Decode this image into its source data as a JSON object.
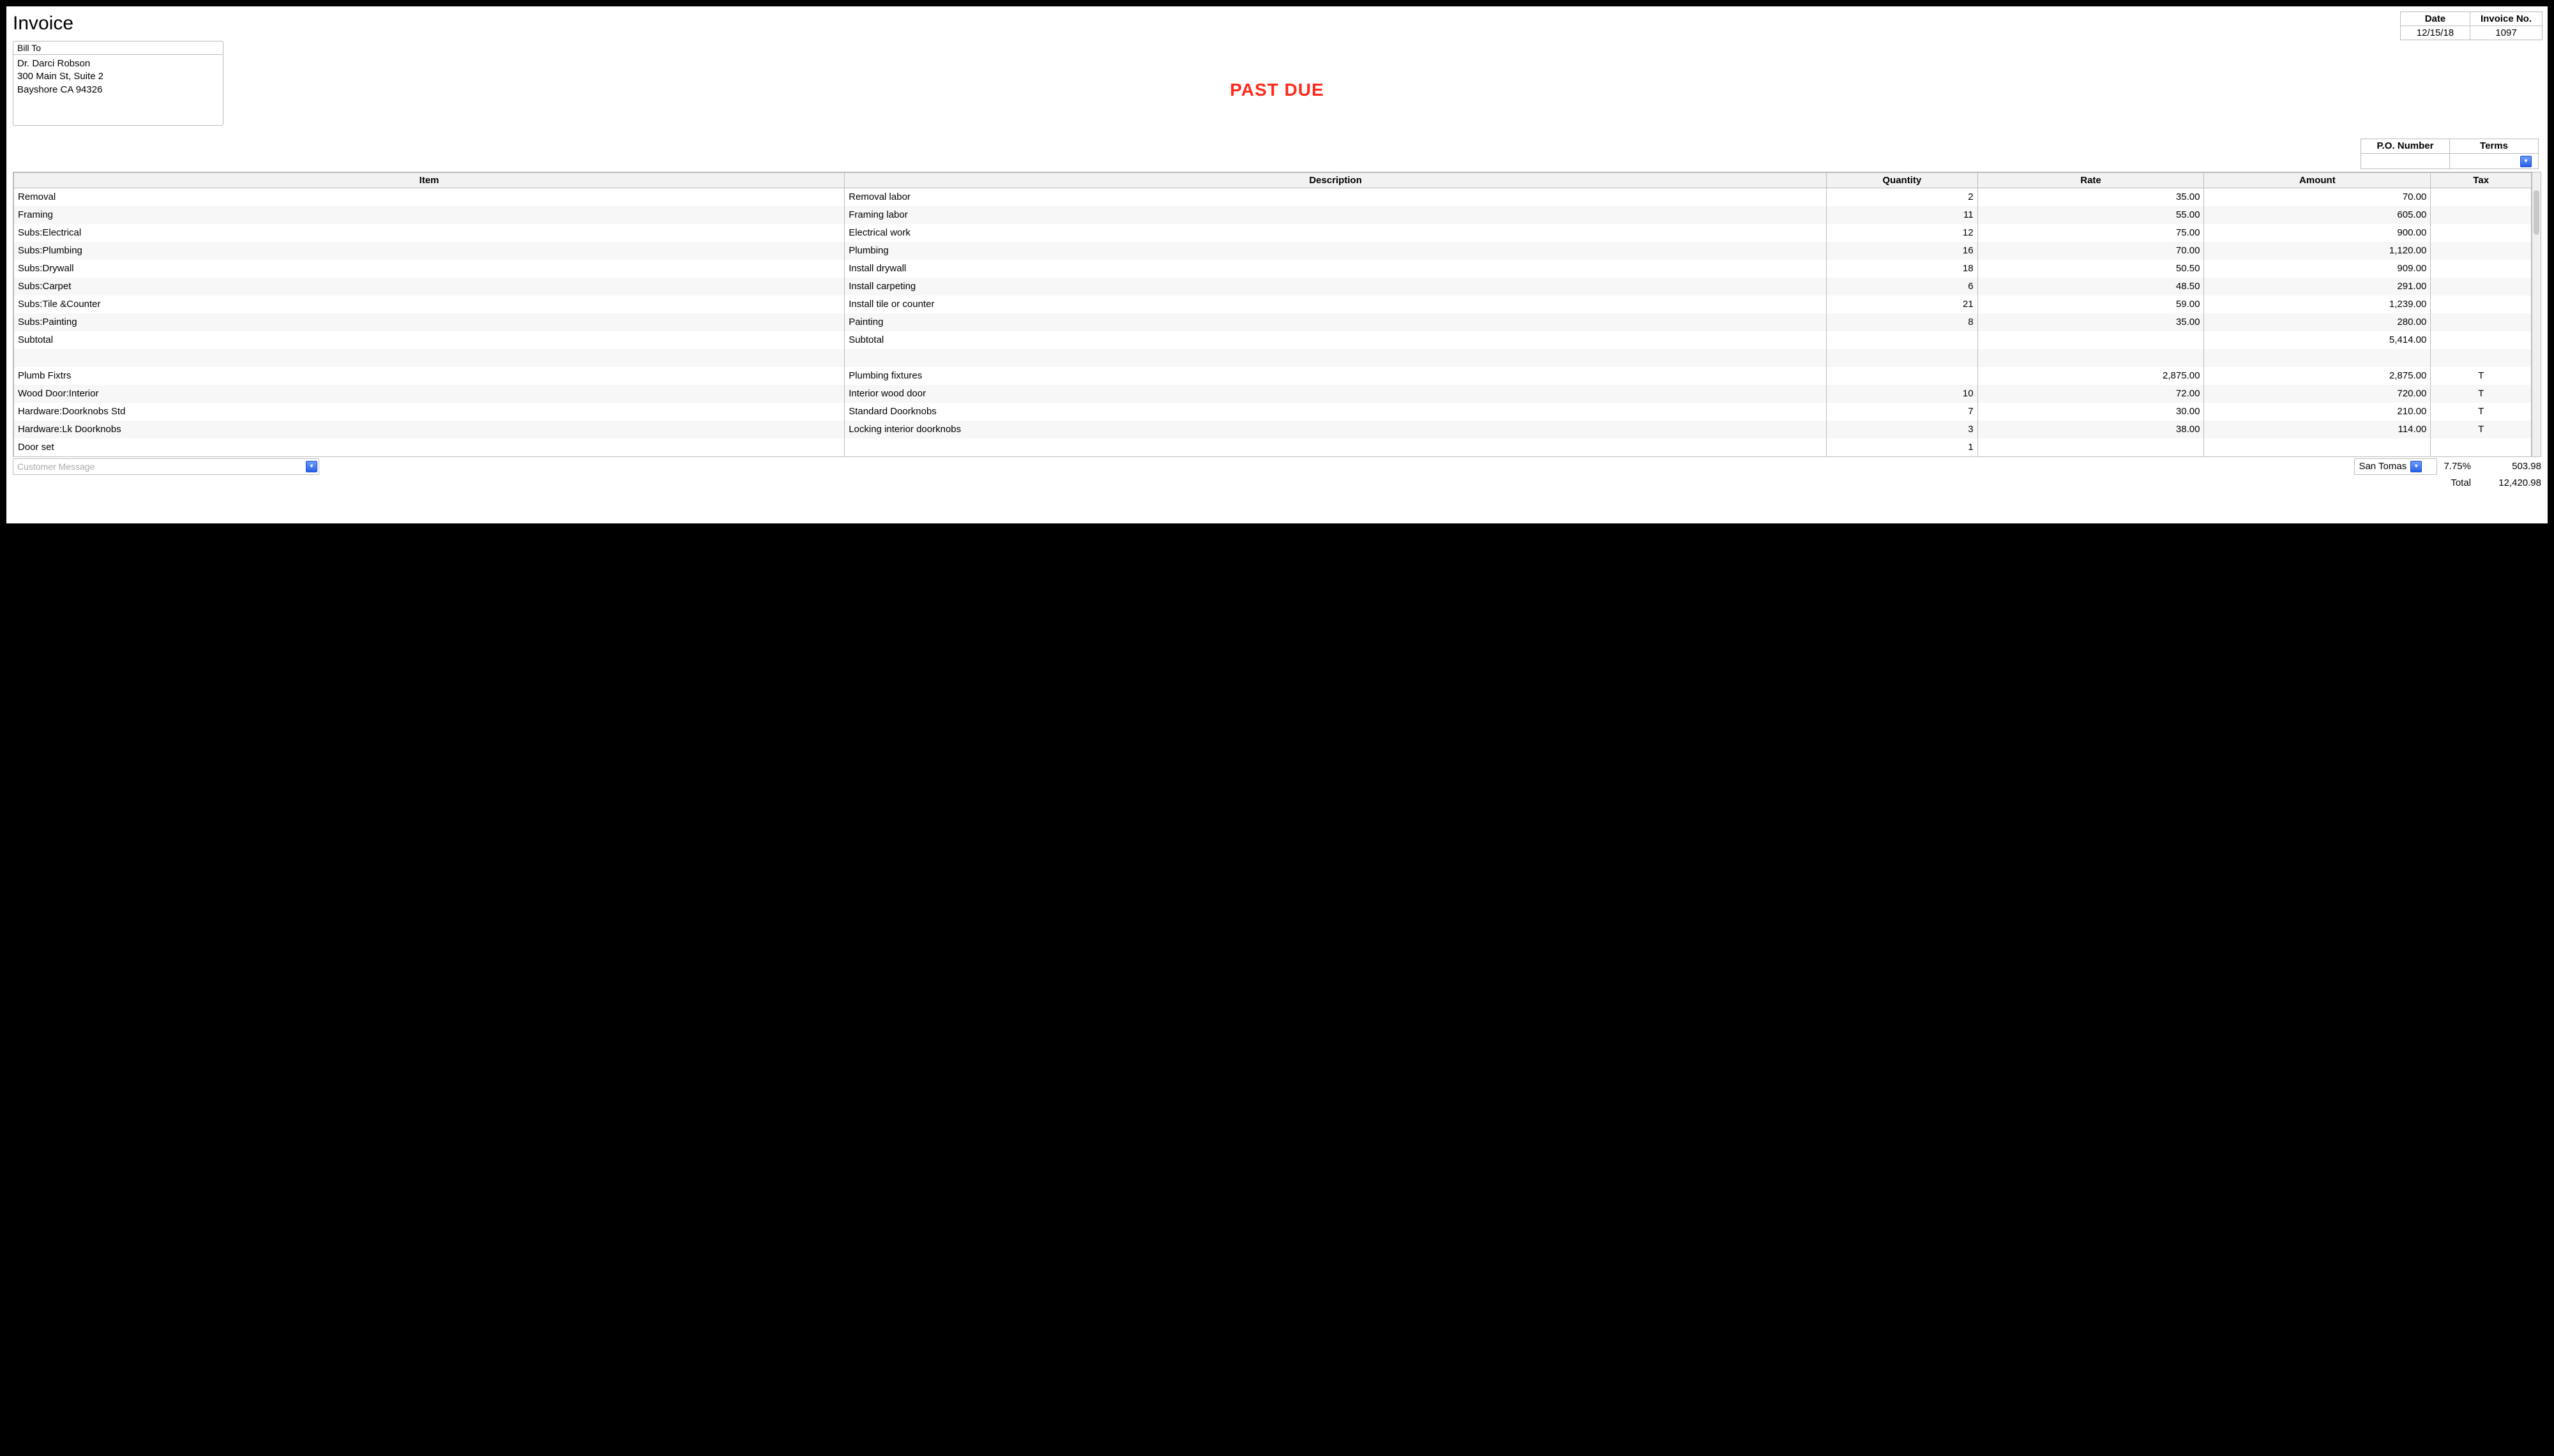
{
  "title": "Invoice",
  "stamp": "PAST DUE",
  "header": {
    "date_label": "Date",
    "date_value": "12/15/18",
    "invno_label": "Invoice No.",
    "invno_value": "1097"
  },
  "bill_to": {
    "label": "Bill To",
    "line1": "Dr. Darci Robson",
    "line2": "300 Main St, Suite 2",
    "line3": "Bayshore CA 94326"
  },
  "po_terms": {
    "po_label": "P.O. Number",
    "po_value": "",
    "terms_label": "Terms",
    "terms_value": ""
  },
  "columns": {
    "item": "Item",
    "description": "Description",
    "quantity": "Quantity",
    "rate": "Rate",
    "amount": "Amount",
    "tax": "Tax"
  },
  "lines": [
    {
      "item": "Removal",
      "desc": "Removal labor",
      "qty": "2",
      "rate": "35.00",
      "amount": "70.00",
      "tax": ""
    },
    {
      "item": "Framing",
      "desc": "Framing labor",
      "qty": "11",
      "rate": "55.00",
      "amount": "605.00",
      "tax": ""
    },
    {
      "item": "Subs:Electrical",
      "desc": "Electrical work",
      "qty": "12",
      "rate": "75.00",
      "amount": "900.00",
      "tax": ""
    },
    {
      "item": "Subs:Plumbing",
      "desc": "Plumbing",
      "qty": "16",
      "rate": "70.00",
      "amount": "1,120.00",
      "tax": ""
    },
    {
      "item": "Subs:Drywall",
      "desc": "Install drywall",
      "qty": "18",
      "rate": "50.50",
      "amount": "909.00",
      "tax": ""
    },
    {
      "item": "Subs:Carpet",
      "desc": "Install carpeting",
      "qty": "6",
      "rate": "48.50",
      "amount": "291.00",
      "tax": ""
    },
    {
      "item": "Subs:Tile &Counter",
      "desc": "Install tile or counter",
      "qty": "21",
      "rate": "59.00",
      "amount": "1,239.00",
      "tax": ""
    },
    {
      "item": "Subs:Painting",
      "desc": "Painting",
      "qty": "8",
      "rate": "35.00",
      "amount": "280.00",
      "tax": ""
    },
    {
      "item": "Subtotal",
      "desc": "Subtotal",
      "qty": "",
      "rate": "",
      "amount": "5,414.00",
      "tax": ""
    },
    {
      "item": "",
      "desc": "",
      "qty": "",
      "rate": "",
      "amount": "",
      "tax": ""
    },
    {
      "item": "Plumb Fixtrs",
      "desc": "Plumbing fixtures",
      "qty": "",
      "rate": "2,875.00",
      "amount": "2,875.00",
      "tax": "T"
    },
    {
      "item": "Wood Door:Interior",
      "desc": "Interior wood door",
      "qty": "10",
      "rate": "72.00",
      "amount": "720.00",
      "tax": "T"
    },
    {
      "item": "Hardware:Doorknobs Std",
      "desc": "Standard Doorknobs",
      "qty": "7",
      "rate": "30.00",
      "amount": "210.00",
      "tax": "T"
    },
    {
      "item": "Hardware:Lk Doorknobs",
      "desc": "Locking interior doorknobs",
      "qty": "3",
      "rate": "38.00",
      "amount": "114.00",
      "tax": "T"
    },
    {
      "item": "Door set",
      "desc": "",
      "qty": "1",
      "rate": "",
      "amount": "",
      "tax": ""
    }
  ],
  "footer": {
    "customer_message_placeholder": "Customer Message",
    "tax_jurisdiction": "San Tomas",
    "tax_rate": "7.75%",
    "tax_amount": "503.98",
    "total_label": "Total",
    "total_value": "12,420.98"
  }
}
